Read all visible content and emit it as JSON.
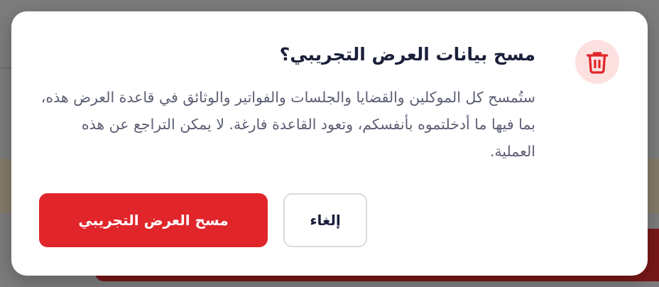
{
  "dialog": {
    "title": "مسح بيانات العرض التجريبي؟",
    "message": "ستُمسح كل الموكلين والقضايا والجلسات والفواتير والوثائق في قاعدة العرض هذه، بما فيها ما أدخلتموه بأنفسكم، وتعود القاعدة فارغة. لا يمكن التراجع عن هذه العملية.",
    "icon": "trash-icon",
    "cancel_label": "إلغاء",
    "confirm_label": "مسح العرض التجريبي"
  },
  "colors": {
    "danger": "#e0262b",
    "icon_bg": "#fde1e1",
    "title": "#1b1f3a",
    "body": "#5c5f73"
  }
}
